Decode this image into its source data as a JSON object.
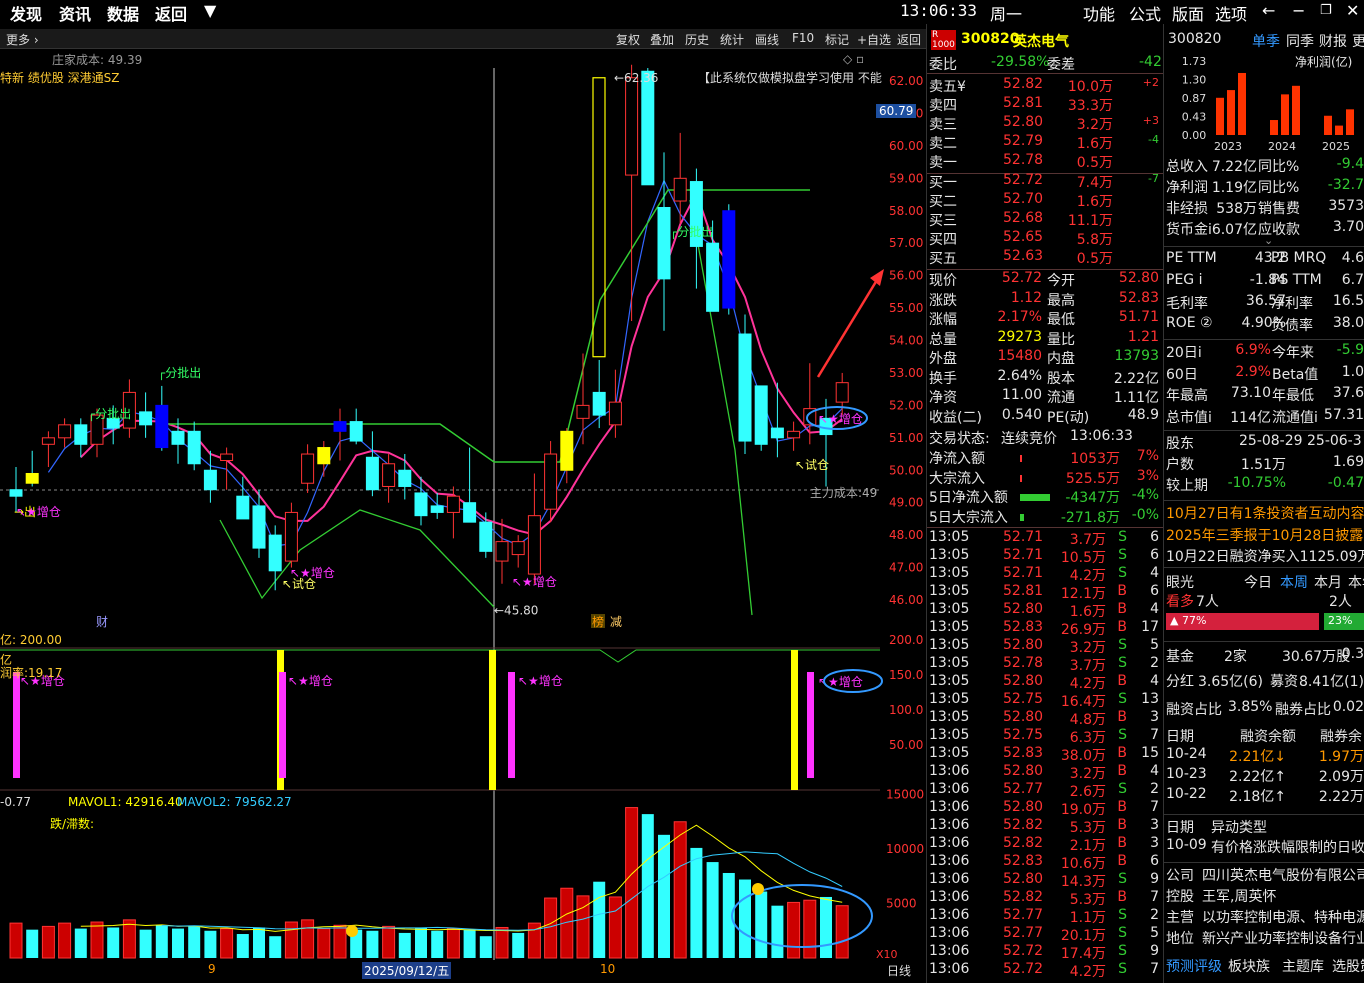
{
  "topbar": {
    "menu": [
      "发现",
      "资讯",
      "数据",
      "返回"
    ],
    "arrow": "▼",
    "time": "13:06:33",
    "weekday": "周一",
    "right_menu": [
      "功能",
      "公式",
      "版面",
      "选项"
    ]
  },
  "toolbar": {
    "more": "更多",
    "buttons": [
      "复权",
      "叠加",
      "历史",
      "统计",
      "画线",
      "F10",
      "标记",
      "+自选",
      "返回"
    ]
  },
  "chart": {
    "cost_label": "庄家成本: 49.39",
    "tags": "特新 绩优股 深港通SZ",
    "notice": "【此系统仅做模拟盘学习使用  不能",
    "price_ticks": [
      "62.00",
      "61.00",
      "60.00",
      "59.00",
      "58.00",
      "57.00",
      "56.00",
      "55.00",
      "54.00",
      "53.00",
      "52.00",
      "51.00",
      "50.00",
      "49.00",
      "48.00",
      "47.00",
      "46.00"
    ],
    "current_price_tag": "60.79",
    "high_label": "62.36",
    "low_label": "45.80",
    "main_cost": "主力成本:49",
    "annotations": {
      "fenpichu": "分批出",
      "zengcang": "增仓",
      "shicang": "试仓",
      "chu": "出"
    },
    "bottom_markers": [
      "财",
      "榜",
      "减"
    ],
    "ind1_label": "200.00",
    "ind1_yi": "亿",
    "ind1_runlv": "润率:19.17",
    "ind1_ticks": [
      "200.0",
      "150.0",
      "100.0",
      "50.00"
    ],
    "vol_label_a": "-0.77",
    "vol_mavol1": "MAVOL1: 42916.40",
    "vol_mavol2": "MAVOL2: 79562.27",
    "vol_diezhang": "跌/滞数:",
    "vol_ticks": [
      "15000",
      "10000",
      "5000"
    ],
    "vol_unit": "X10",
    "date_labels": [
      "9",
      "2025/09/12/五",
      "10"
    ],
    "period": "日线"
  },
  "quote": {
    "code": "300820",
    "name": "英杰电气",
    "badge": "R",
    "weibi_label": "委比",
    "weibi": "-29.58%",
    "weicha_label": "委差",
    "weicha": "-42",
    "asks": [
      {
        "label": "卖五",
        "mark": "¥",
        "price": "52.82",
        "vol": "10.0万",
        "chg": "+2"
      },
      {
        "label": "卖四",
        "mark": "",
        "price": "52.81",
        "vol": "33.3万",
        "chg": ""
      },
      {
        "label": "卖三",
        "mark": "",
        "price": "52.80",
        "vol": "3.2万",
        "chg": "+3"
      },
      {
        "label": "卖二",
        "mark": "",
        "price": "52.79",
        "vol": "1.6万",
        "chg": "-4"
      },
      {
        "label": "卖一",
        "mark": "",
        "price": "52.78",
        "vol": "0.5万",
        "chg": ""
      }
    ],
    "bids": [
      {
        "label": "买一",
        "price": "52.72",
        "vol": "7.4万",
        "chg": "-7"
      },
      {
        "label": "买二",
        "price": "52.70",
        "vol": "1.6万",
        "chg": ""
      },
      {
        "label": "买三",
        "price": "52.68",
        "vol": "11.1万",
        "chg": ""
      },
      {
        "label": "买四",
        "price": "52.65",
        "vol": "5.8万",
        "chg": ""
      },
      {
        "label": "买五",
        "price": "52.63",
        "vol": "0.5万",
        "chg": ""
      }
    ],
    "stats": [
      {
        "l1": "现价",
        "v1": "52.72",
        "c1": "red",
        "l2": "今开",
        "v2": "52.80",
        "c2": "red"
      },
      {
        "l1": "涨跌",
        "v1": "1.12",
        "c1": "red",
        "l2": "最高",
        "v2": "52.83",
        "c2": "red"
      },
      {
        "l1": "涨幅",
        "v1": "2.17%",
        "c1": "red",
        "l2": "最低",
        "v2": "51.71",
        "c2": "red"
      },
      {
        "l1": "总量",
        "v1": "29273",
        "c1": "yellow",
        "l2": "量比",
        "v2": "1.21",
        "c2": "red"
      },
      {
        "l1": "外盘",
        "v1": "15480",
        "c1": "red",
        "l2": "内盘",
        "v2": "13793",
        "c2": "green"
      },
      {
        "l1": "换手",
        "v1": "2.64%",
        "c1": "white",
        "l2": "股本",
        "v2": "2.22亿",
        "c2": "white"
      },
      {
        "l1": "净资",
        "v1": "11.00",
        "c1": "white",
        "l2": "流通",
        "v2": "1.11亿",
        "c2": "white"
      },
      {
        "l1": "收益(二)",
        "v1": "0.540",
        "c1": "white",
        "l2": "PE(动)",
        "v2": "48.9",
        "c2": "white"
      }
    ],
    "trade_status_label": "交易状态:",
    "trade_status": "连续竞价",
    "trade_time": "13:06:33",
    "flows": [
      {
        "label": "净流入额",
        "value": "1053万",
        "pct": "7%",
        "color": "red"
      },
      {
        "label": "大宗流入",
        "value": "525.5万",
        "pct": "3%",
        "color": "red"
      },
      {
        "label": "5日净流入额",
        "value": "-4347万",
        "pct": "-4%",
        "color": "green"
      },
      {
        "label": "5日大宗流入",
        "value": "-271.8万",
        "pct": "-0%",
        "color": "green"
      }
    ],
    "ticks": [
      {
        "t": "13:05",
        "p": "52.71",
        "v": "3.7万",
        "s": "S",
        "n": "6"
      },
      {
        "t": "13:05",
        "p": "52.71",
        "v": "10.5万",
        "s": "S",
        "n": "6"
      },
      {
        "t": "13:05",
        "p": "52.71",
        "v": "4.2万",
        "s": "S",
        "n": "4"
      },
      {
        "t": "13:05",
        "p": "52.81",
        "v": "12.1万",
        "s": "B",
        "n": "6"
      },
      {
        "t": "13:05",
        "p": "52.80",
        "v": "1.6万",
        "s": "B",
        "n": "4"
      },
      {
        "t": "13:05",
        "p": "52.83",
        "v": "26.9万",
        "s": "B",
        "n": "17"
      },
      {
        "t": "13:05",
        "p": "52.80",
        "v": "3.2万",
        "s": "S",
        "n": "5"
      },
      {
        "t": "13:05",
        "p": "52.78",
        "v": "3.7万",
        "s": "S",
        "n": "2"
      },
      {
        "t": "13:05",
        "p": "52.80",
        "v": "4.2万",
        "s": "B",
        "n": "4"
      },
      {
        "t": "13:05",
        "p": "52.75",
        "v": "16.4万",
        "s": "S",
        "n": "13"
      },
      {
        "t": "13:05",
        "p": "52.80",
        "v": "4.8万",
        "s": "B",
        "n": "3"
      },
      {
        "t": "13:05",
        "p": "52.75",
        "v": "6.3万",
        "s": "S",
        "n": "7"
      },
      {
        "t": "13:05",
        "p": "52.83",
        "v": "38.0万",
        "s": "B",
        "n": "15"
      },
      {
        "t": "13:06",
        "p": "52.80",
        "v": "3.2万",
        "s": "B",
        "n": "4"
      },
      {
        "t": "13:06",
        "p": "52.77",
        "v": "2.6万",
        "s": "S",
        "n": "2"
      },
      {
        "t": "13:06",
        "p": "52.80",
        "v": "19.0万",
        "s": "B",
        "n": "7"
      },
      {
        "t": "13:06",
        "p": "52.82",
        "v": "5.3万",
        "s": "B",
        "n": "3"
      },
      {
        "t": "13:06",
        "p": "52.82",
        "v": "2.1万",
        "s": "B",
        "n": "3"
      },
      {
        "t": "13:06",
        "p": "52.83",
        "v": "10.6万",
        "s": "B",
        "n": "6"
      },
      {
        "t": "13:06",
        "p": "52.80",
        "v": "14.3万",
        "s": "S",
        "n": "9"
      },
      {
        "t": "13:06",
        "p": "52.82",
        "v": "5.3万",
        "s": "B",
        "n": "7"
      },
      {
        "t": "13:06",
        "p": "52.77",
        "v": "1.1万",
        "s": "S",
        "n": "2"
      },
      {
        "t": "13:06",
        "p": "52.77",
        "v": "20.1万",
        "s": "S",
        "n": "5"
      },
      {
        "t": "13:06",
        "p": "52.72",
        "v": "17.4万",
        "s": "S",
        "n": "9"
      },
      {
        "t": "13:06",
        "p": "52.72",
        "v": "4.2万",
        "s": "S",
        "n": "7"
      }
    ]
  },
  "f10": {
    "code": "300820",
    "tabs": [
      "单季",
      "同季",
      "财报",
      "更多"
    ],
    "chart_title": "净利润(亿)",
    "y_ticks": [
      "1.73",
      "1.30",
      "0.87",
      "0.43",
      "0.00"
    ],
    "years": [
      "2023",
      "2024",
      "2025"
    ],
    "bar_values": [
      0.87,
      1.05,
      1.45,
      0.35,
      0.95,
      1.15,
      0.45,
      0.22,
      0.6
    ],
    "fin": [
      {
        "l": "总收入",
        "v": "7.22亿",
        "l2": "同比%",
        "v2": "-9.4"
      },
      {
        "l": "净利润",
        "v": "1.19亿",
        "l2": "同比%",
        "v2": "-32.7"
      },
      {
        "l": "非经损",
        "v": "538万",
        "l2": "销售费",
        "v2": "3573"
      },
      {
        "l": "货币金i",
        "v": "6.07亿",
        "l2": "应收款",
        "v2": "3.70"
      }
    ],
    "val": [
      {
        "l": "PE",
        "sup": "TTM",
        "v": "43.2",
        "l2": "PB",
        "sup2": "MRQ",
        "v2": "4.6"
      },
      {
        "l": "PEG",
        "sup": "i",
        "v": "-1.84",
        "l2": "PS",
        "sup2": "TTM",
        "v2": "6.7"
      },
      {
        "l": "毛利率",
        "sup": "",
        "v": "36.57",
        "l2": "净利率",
        "sup2": "",
        "v2": "16.5"
      },
      {
        "l": "ROE",
        "sup": "②",
        "v": "4.90%",
        "l2": "负债率",
        "sup2": "",
        "v2": "38.0"
      }
    ],
    "perf": [
      {
        "l": "20日i",
        "v": "6.9%",
        "l2": "今年来",
        "v2": "-5.9",
        "c": "red",
        "c2": "green"
      },
      {
        "l": "60日",
        "v": "2.9%",
        "l2": "Beta值",
        "v2": "1.0",
        "c": "red",
        "c2": "white"
      },
      {
        "l": "年最高",
        "v": "73.10",
        "l2": "年最低",
        "v2": "37.6",
        "c": "white",
        "c2": "white"
      },
      {
        "l": "总市值i",
        "v": "114亿",
        "l2": "流通值i",
        "v2": "57.31",
        "c": "white",
        "c2": "white"
      }
    ],
    "holders": {
      "label": "股东",
      "d1": "25-08-29",
      "d2": "25-06-3",
      "rows": [
        {
          "l": "户数",
          "v1": "1.51万",
          "v2": "1.69"
        },
        {
          "l": "较上期",
          "v1": "-10.75%",
          "v2": "-0.47"
        }
      ]
    },
    "news": [
      "10月27日有1条投资者互动内容",
      "2025年三季报于10月28日披露(-",
      "10月22日融资净买入1125.09万"
    ],
    "eye": {
      "label": "眼光",
      "tabs": [
        "今日",
        "本周",
        "本月",
        "本年"
      ],
      "bull_label": "看多",
      "bull_count": "7人",
      "bear_count": "2人",
      "bull_pct": "77%",
      "bear_pct": "23%"
    },
    "fund": {
      "l": "基金",
      "v": "2家",
      "v2": "30.67万股",
      "v3": "0.3"
    },
    "div": {
      "l": "分红",
      "v": "3.65亿(6)",
      "l2": "募资",
      "v2": "8.41亿(1)"
    },
    "margin": {
      "l": "融资占比",
      "v": "3.85%",
      "l2": "融券占比",
      "v2": "0.02"
    },
    "margin_table": {
      "headers": [
        "日期",
        "融资余额",
        "融券余"
      ],
      "rows": [
        {
          "d": "10-24",
          "a": "2.21亿↓",
          "b": "1.97万",
          "c": "orange"
        },
        {
          "d": "10-23",
          "a": "2.22亿↑",
          "b": "2.09万",
          "c": "white"
        },
        {
          "d": "10-22",
          "a": "2.18亿↑",
          "b": "2.22万",
          "c": "white"
        }
      ]
    },
    "abnormal": {
      "headers": [
        "日期",
        "异动类型"
      ],
      "row": {
        "d": "10-09",
        "t": "有价格涨跌幅限制的日收"
      }
    },
    "company": [
      {
        "l": "公司",
        "v": "四川英杰电气股份有限公司"
      },
      {
        "l": "控股",
        "v": "王军,周英怀"
      },
      {
        "l": "主营",
        "v": "以功率控制电源、特种电源"
      },
      {
        "l": "地位",
        "v": "新兴产业功率控制设备行业"
      }
    ],
    "bottom_links": [
      "预测评级",
      "板块族",
      "主题库",
      "选股策略"
    ]
  },
  "colors": {
    "up": "#ff3333",
    "down": "#33ffff",
    "ma_pink": "#ff3399",
    "ma_green": "#33cc33",
    "ma_blue": "#3366ff",
    "magenta": "#ff33ff",
    "yellow": "#ffff00"
  },
  "chart_data": {
    "type": "candlestick",
    "candles": [
      {
        "o": 49.4,
        "h": 50.1,
        "l": 48.7,
        "c": 49.2
      },
      {
        "o": 49.9,
        "h": 50.6,
        "l": 49.5,
        "c": 49.6
      },
      {
        "o": 50.8,
        "h": 51.2,
        "l": 50.1,
        "c": 51.0
      },
      {
        "o": 51.0,
        "h": 51.6,
        "l": 50.7,
        "c": 51.4
      },
      {
        "o": 51.4,
        "h": 51.6,
        "l": 50.4,
        "c": 50.8
      },
      {
        "o": 50.8,
        "h": 51.9,
        "l": 50.4,
        "c": 51.7
      },
      {
        "o": 51.6,
        "h": 52.0,
        "l": 50.8,
        "c": 51.3
      },
      {
        "o": 51.3,
        "h": 52.8,
        "l": 51.0,
        "c": 52.4
      },
      {
        "o": 51.8,
        "h": 52.4,
        "l": 51.0,
        "c": 51.4
      },
      {
        "o": 52.0,
        "h": 52.6,
        "l": 50.6,
        "c": 50.7
      },
      {
        "o": 51.2,
        "h": 51.6,
        "l": 50.2,
        "c": 50.8
      },
      {
        "o": 51.2,
        "h": 51.5,
        "l": 50.0,
        "c": 50.2
      },
      {
        "o": 50.0,
        "h": 50.6,
        "l": 49.0,
        "c": 49.4
      },
      {
        "o": 50.3,
        "h": 50.7,
        "l": 49.4,
        "c": 50.5
      },
      {
        "o": 49.2,
        "h": 49.8,
        "l": 48.6,
        "c": 48.5
      },
      {
        "o": 48.9,
        "h": 49.4,
        "l": 47.3,
        "c": 47.6
      },
      {
        "o": 48.0,
        "h": 48.3,
        "l": 46.3,
        "c": 46.9
      },
      {
        "o": 47.2,
        "h": 49.0,
        "l": 47.0,
        "c": 48.7
      },
      {
        "o": 49.6,
        "h": 50.8,
        "l": 49.3,
        "c": 50.5
      },
      {
        "o": 50.2,
        "h": 50.9,
        "l": 49.8,
        "c": 50.7
      },
      {
        "o": 51.2,
        "h": 51.9,
        "l": 50.3,
        "c": 51.5
      },
      {
        "o": 51.5,
        "h": 51.9,
        "l": 50.8,
        "c": 50.9
      },
      {
        "o": 50.4,
        "h": 51.2,
        "l": 49.2,
        "c": 49.4
      },
      {
        "o": 49.5,
        "h": 50.5,
        "l": 49.0,
        "c": 50.2
      },
      {
        "o": 50.0,
        "h": 50.5,
        "l": 49.1,
        "c": 49.5
      },
      {
        "o": 49.3,
        "h": 49.8,
        "l": 48.3,
        "c": 48.6
      },
      {
        "o": 48.9,
        "h": 49.3,
        "l": 48.5,
        "c": 48.7
      },
      {
        "o": 48.7,
        "h": 49.5,
        "l": 47.9,
        "c": 49.2
      },
      {
        "o": 49.0,
        "h": 50.7,
        "l": 48.6,
        "c": 48.4
      },
      {
        "o": 48.4,
        "h": 48.7,
        "l": 47.3,
        "c": 47.5
      },
      {
        "o": 47.2,
        "h": 48.5,
        "l": 46.5,
        "c": 47.8
      },
      {
        "o": 47.4,
        "h": 48.0,
        "l": 47.0,
        "c": 47.8
      },
      {
        "o": 46.8,
        "h": 49.9,
        "l": 46.5,
        "c": 48.6
      },
      {
        "o": 48.8,
        "h": 50.9,
        "l": 48.4,
        "c": 50.5
      },
      {
        "o": 50.0,
        "h": 51.3,
        "l": 49.6,
        "c": 51.2
      },
      {
        "o": 51.6,
        "h": 53.6,
        "l": 50.8,
        "c": 52.0
      },
      {
        "o": 52.4,
        "h": 53.4,
        "l": 51.3,
        "c": 51.7
      },
      {
        "o": 51.4,
        "h": 53.1,
        "l": 51.0,
        "c": 52.1
      },
      {
        "o": 59.1,
        "h": 62.5,
        "l": 54.6,
        "c": 62.1
      },
      {
        "o": 62.3,
        "h": 62.4,
        "l": 59.0,
        "c": 58.8
      },
      {
        "o": 58.1,
        "h": 59.8,
        "l": 54.3,
        "c": 55.9
      },
      {
        "o": 58.3,
        "h": 60.4,
        "l": 57.6,
        "c": 59.0
      },
      {
        "o": 58.9,
        "h": 59.3,
        "l": 55.6,
        "c": 56.9
      },
      {
        "o": 57.0,
        "h": 57.7,
        "l": 54.9,
        "c": 54.9
      },
      {
        "o": 58.0,
        "h": 58.2,
        "l": 54.8,
        "c": 55.0
      },
      {
        "o": 54.2,
        "h": 54.8,
        "l": 50.5,
        "c": 50.9
      },
      {
        "o": 52.6,
        "h": 52.3,
        "l": 50.6,
        "c": 50.8
      },
      {
        "o": 51.3,
        "h": 52.7,
        "l": 50.4,
        "c": 51.0
      },
      {
        "o": 51.0,
        "h": 51.5,
        "l": 50.6,
        "c": 51.2
      },
      {
        "o": 51.4,
        "h": 53.3,
        "l": 50.8,
        "c": 51.9
      },
      {
        "o": 51.6,
        "h": 52.2,
        "l": 49.5,
        "c": 51.1
      },
      {
        "o": 52.1,
        "h": 53.0,
        "l": 51.7,
        "c": 52.7
      }
    ],
    "volumes": [
      3200,
      2600,
      2900,
      3200,
      2700,
      3300,
      2800,
      3500,
      2600,
      3000,
      2700,
      2900,
      2500,
      2700,
      2200,
      2800,
      2000,
      3300,
      3500,
      2700,
      3000,
      2600,
      2500,
      2900,
      2300,
      2800,
      2500,
      2700,
      2600,
      2000,
      2800,
      2300,
      3200,
      5500,
      6400,
      5700,
      7000,
      5600,
      13800,
      13200,
      11300,
      12500,
      10100,
      8800,
      7800,
      7200,
      6100,
      4800,
      5100,
      5300,
      5600,
      4800
    ],
    "volume_up": [
      true,
      false,
      true,
      true,
      false,
      true,
      false,
      true,
      false,
      false,
      false,
      false,
      false,
      true,
      false,
      false,
      false,
      true,
      true,
      true,
      true,
      false,
      false,
      true,
      false,
      false,
      false,
      true,
      false,
      false,
      true,
      false,
      true,
      true,
      true,
      true,
      false,
      true,
      true,
      false,
      false,
      true,
      false,
      false,
      false,
      false,
      false,
      false,
      true,
      true,
      false,
      true
    ]
  }
}
